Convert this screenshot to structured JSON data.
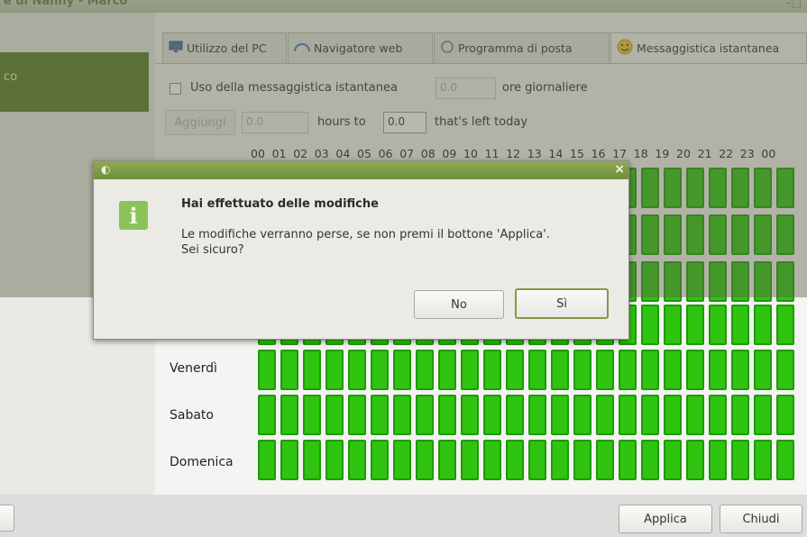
{
  "window": {
    "title": "e di Nanny - Marco",
    "controls": "–□"
  },
  "sidebar": {
    "selected_label": "co"
  },
  "tabs": [
    {
      "label": "Utilizzo del PC",
      "icon": "monitor-icon"
    },
    {
      "label": "Navigatore web",
      "icon": "globe-icon"
    },
    {
      "label": "Programma di posta",
      "icon": "mail-icon"
    },
    {
      "label": "Messaggistica istantanea",
      "icon": "smiley-icon"
    }
  ],
  "im": {
    "checkbox_label": "Uso della messaggistica istantanea",
    "hours_value": "0.0",
    "hours_suffix": "ore giornaliere",
    "add_button": "Aggiungi",
    "add_value": "0.0",
    "hours_to": "hours to",
    "left_value": "0.0",
    "left_suffix": "that's left today"
  },
  "schedule": {
    "hours": [
      "00",
      "01",
      "02",
      "03",
      "04",
      "05",
      "06",
      "07",
      "08",
      "09",
      "10",
      "11",
      "12",
      "13",
      "14",
      "15",
      "16",
      "17",
      "18",
      "19",
      "20",
      "21",
      "22",
      "23",
      "00"
    ],
    "days": [
      "Venerdì",
      "Sabato",
      "Domenica"
    ],
    "cell_color": "#2fc40f"
  },
  "dialog": {
    "heading": "Hai effettuato delle modifiche",
    "message_line1": "Le modifiche verranno perse, se non premi il bottone 'Applica'.",
    "message_line2": "Sei sicuro?",
    "no_label": "No",
    "yes_label": "Sì"
  },
  "footer": {
    "apply_label": "Applica",
    "close_label": "Chiudi"
  },
  "colors": {
    "accent": "#567a25",
    "titlebar": "#7f9c47"
  }
}
